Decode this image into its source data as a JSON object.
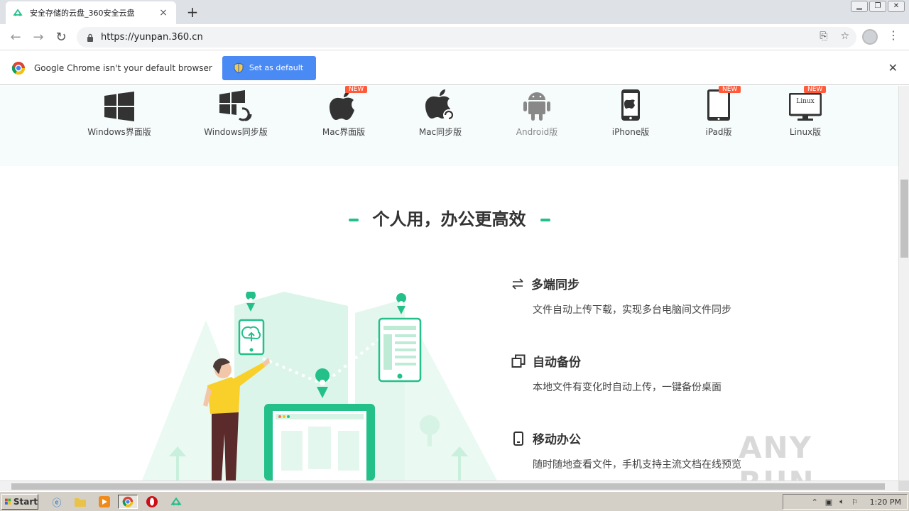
{
  "browser": {
    "tab_title": "安全存储的云盘_360安全云盘",
    "tab_close": "×",
    "new_tab": "+",
    "url": "https://yunpan.360.cn",
    "window_buttons": [
      "▁",
      "❐",
      "✕"
    ]
  },
  "infobar": {
    "message": "Google Chrome isn't your default browser",
    "button_label": "Set as default",
    "close": "✕"
  },
  "downloads": {
    "items": [
      {
        "label": "Windows界面版",
        "icon": "windows-icon",
        "badge": ""
      },
      {
        "label": "Windows同步版",
        "icon": "windows-sync-icon",
        "badge": ""
      },
      {
        "label": "Mac界面版",
        "icon": "apple-icon",
        "badge": "NEW"
      },
      {
        "label": "Mac同步版",
        "icon": "apple-sync-icon",
        "badge": ""
      },
      {
        "label": "Android版",
        "icon": "android-icon",
        "badge": ""
      },
      {
        "label": "iPhone版",
        "icon": "iphone-icon",
        "badge": ""
      },
      {
        "label": "iPad版",
        "icon": "ipad-icon",
        "badge": "NEW"
      },
      {
        "label": "Linux版",
        "icon": "linux-icon",
        "badge": "NEW",
        "screen_text": "Linux"
      }
    ]
  },
  "section": {
    "title": "个人用，办公更高效"
  },
  "features": [
    {
      "title": "多端同步",
      "desc": "文件自动上传下载，实现多台电脑间文件同步",
      "icon": "sync-arrows-icon"
    },
    {
      "title": "自动备份",
      "desc": "本地文件有变化时自动上传，一键备份桌面",
      "icon": "copy-icon"
    },
    {
      "title": "移动办公",
      "desc": "随时随地查看文件，手机支持主流文档在线预览",
      "icon": "mobile-icon"
    }
  ],
  "watermark": "ANY RUN",
  "taskbar": {
    "start_label": "Start",
    "time": "1:20 PM"
  },
  "colors": {
    "accent_green": "#23c08a",
    "chrome_blue": "#4a8af4",
    "badge_red": "#ff5a3a"
  }
}
